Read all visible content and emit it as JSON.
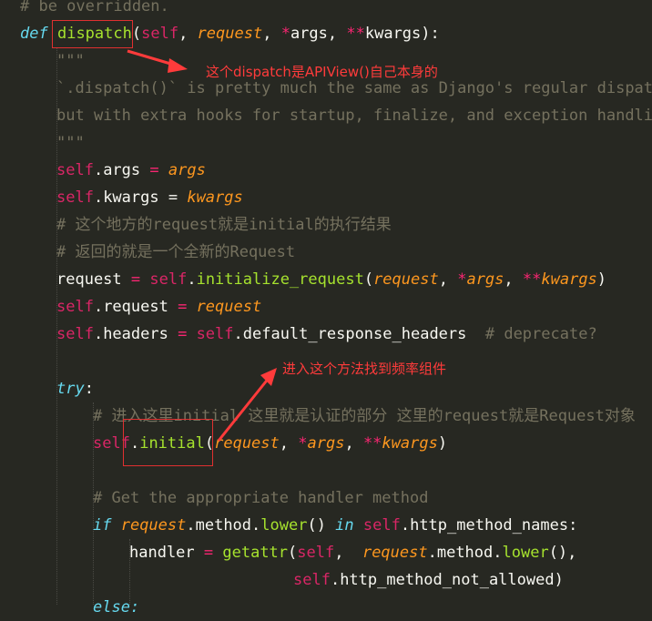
{
  "code": {
    "l0": "# be overridden.",
    "def_kw": "def",
    "def_name": "dispatch",
    "def_open": "(",
    "def_self": "self",
    "def_comma1": ", ",
    "def_request": "request",
    "def_comma2": ", ",
    "def_star": "*",
    "def_args": "args",
    "def_comma3": ", ",
    "def_dstar": "**",
    "def_kwargs": "kwargs",
    "def_close": "):",
    "doc_open": "\"\"\"",
    "doc1": "`.dispatch()` is pretty much the same as Django's regular dispatch,",
    "doc2": "but with extra hooks for startup, finalize, and exception handling.",
    "doc_close": "\"\"\"",
    "a1_self": "self",
    "a1_attr": ".args ",
    "a1_eq": "=",
    "a1_val": " args",
    "a2_self": "self",
    "a2_attr": ".kwargs ",
    "a2_eq": "=",
    "a2_val": " kwargs",
    "c1": "# 这个地方的request就是initial的执行结果",
    "c2": "# 返回的就是一个全新的Request",
    "r_name": "request ",
    "r_eq": "=",
    "r_self": " self",
    "r_dot": ".",
    "r_fn": "initialize_request",
    "r_open": "(",
    "r_req": "request",
    "r_c1": ", ",
    "r_star": "*",
    "r_args": "args",
    "r_c2": ", ",
    "r_dstar": "**",
    "r_kwargs": "kwargs",
    "r_close": ")",
    "sr_self": "self",
    "sr_attr": ".request ",
    "sr_eq": "=",
    "sr_val": " request",
    "h_self": "self",
    "h_attr": ".headers ",
    "h_eq": "=",
    "h_self2": " self",
    "h_rest": ".default_response_headers",
    "h_com": "  # deprecate?",
    "try_kw": "try",
    "try_colon": ":",
    "c3": "# 进入这里initial 这里就是认证的部分 这里的request就是Request对象",
    "i_self": "self",
    "i_dot": ".",
    "i_fn": "initial",
    "i_open": "(",
    "i_req": "request",
    "i_c1": ", ",
    "i_star": "*",
    "i_args": "args",
    "i_c2": ", ",
    "i_dstar": "**",
    "i_kwargs": "kwargs",
    "i_close": ")",
    "c4": "# Get the appropriate handler method",
    "if_kw": "if",
    "if_req": " request",
    "if_m": ".method.",
    "if_lower": "lower",
    "if_paren": "() ",
    "if_in": "in",
    "if_self": " self",
    "if_rest": ".http_method_names",
    "if_colon": ":",
    "hd_name": "handler ",
    "hd_eq": "=",
    "hd_fn": " getattr",
    "hd_open": "(",
    "hd_self": "self",
    "hd_c": ", ",
    "hd_req": " request",
    "hd_m": ".method.",
    "hd_lower": "lower",
    "hd_rest": "(),",
    "na_self": "self",
    "na_rest": ".http_method_not_allowed)",
    "else_kw": "else:"
  },
  "annotations": {
    "dispatch_note": "这个dispatch是APIView()自己本身的",
    "initial_note": "进入这个方法找到频率组件"
  },
  "colors": {
    "background": "#272822",
    "annotation": "#ff3b3b",
    "keyword": "#66D9EF",
    "function": "#A6E22E",
    "parameter": "#FD971F",
    "operator": "#F92672",
    "comment": "#75715E"
  }
}
